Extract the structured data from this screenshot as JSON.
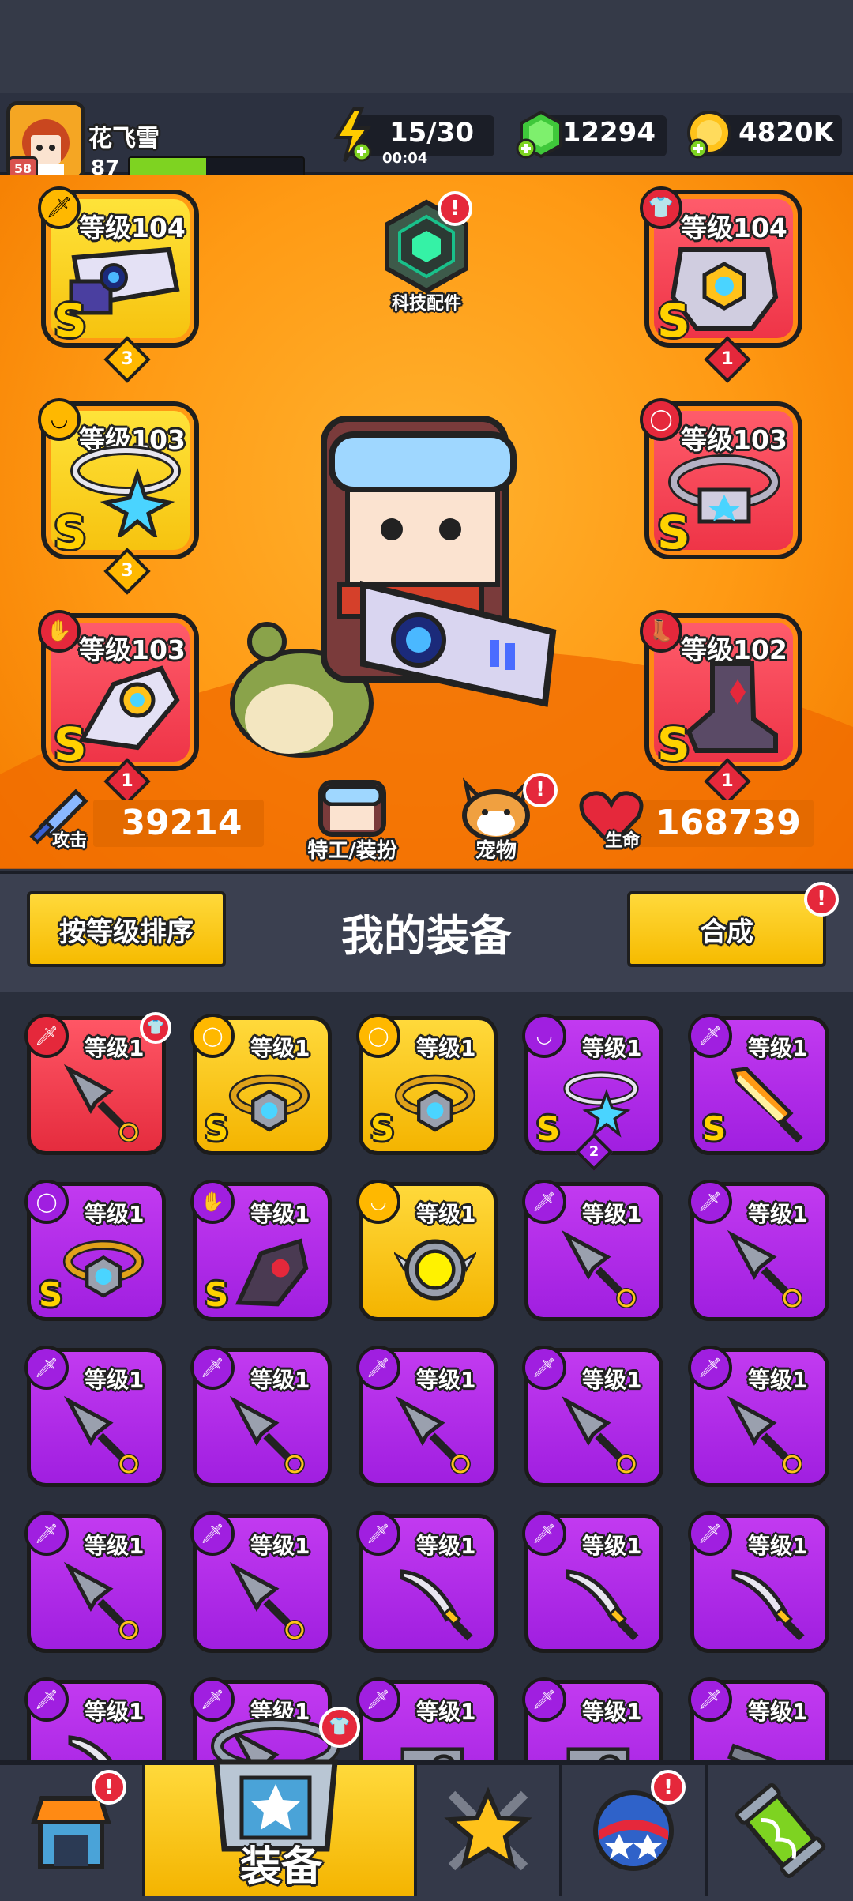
{
  "player": {
    "name": "花飞雪",
    "avatar_level": "58",
    "xp_level": "87",
    "xp_fraction": 0.44
  },
  "resources": {
    "energy": "15/30",
    "energy_timer": "00:04",
    "gems": "12294",
    "coins": "4820K"
  },
  "equipped": {
    "weapon": {
      "label": "等级104",
      "grade": "S",
      "stars": "3"
    },
    "armor": {
      "label": "等级104",
      "grade": "S",
      "stars": "1"
    },
    "necklace": {
      "label": "等级103",
      "grade": "S",
      "stars": "3"
    },
    "belt": {
      "label": "等级103",
      "grade": "S"
    },
    "glove": {
      "label": "等级103",
      "grade": "S",
      "stars": "1"
    },
    "boots": {
      "label": "等级102",
      "grade": "S",
      "stars": "1"
    }
  },
  "tech_parts_label": "科技配件",
  "stats": {
    "attack_label": "攻击",
    "attack_value": "39214",
    "hp_label": "生命",
    "hp_value": "168739"
  },
  "agent_label": "特工/装扮",
  "pet_label": "宠物",
  "inventory": {
    "sort_button": "按等级排序",
    "title": "我的装备",
    "merge_button": "合成",
    "items": [
      {
        "level": "等级1",
        "quality": "red",
        "type": "kunai",
        "grade": ""
      },
      {
        "level": "等级1",
        "quality": "yellow",
        "type": "belt",
        "grade": "S"
      },
      {
        "level": "等级1",
        "quality": "yellow",
        "type": "belt",
        "grade": "S"
      },
      {
        "level": "等级1",
        "quality": "purple",
        "type": "necklace",
        "grade": "S",
        "stars": "2"
      },
      {
        "level": "等级1",
        "quality": "purple",
        "type": "sword",
        "grade": "S"
      },
      {
        "level": "等级1",
        "quality": "purple",
        "type": "belt",
        "grade": "S"
      },
      {
        "level": "等级1",
        "quality": "purple",
        "type": "glove",
        "grade": "S"
      },
      {
        "level": "等级1",
        "quality": "yellow",
        "type": "ring",
        "grade": ""
      },
      {
        "level": "等级1",
        "quality": "purple",
        "type": "kunai",
        "grade": ""
      },
      {
        "level": "等级1",
        "quality": "purple",
        "type": "kunai",
        "grade": ""
      },
      {
        "level": "等级1",
        "quality": "purple",
        "type": "kunai",
        "grade": ""
      },
      {
        "level": "等级1",
        "quality": "purple",
        "type": "kunai",
        "grade": ""
      },
      {
        "level": "等级1",
        "quality": "purple",
        "type": "kunai",
        "grade": ""
      },
      {
        "level": "等级1",
        "quality": "purple",
        "type": "kunai",
        "grade": ""
      },
      {
        "level": "等级1",
        "quality": "purple",
        "type": "kunai",
        "grade": ""
      },
      {
        "level": "等级1",
        "quality": "purple",
        "type": "kunai",
        "grade": ""
      },
      {
        "level": "等级1",
        "quality": "purple",
        "type": "kunai",
        "grade": ""
      },
      {
        "level": "等级1",
        "quality": "purple",
        "type": "katana",
        "grade": ""
      },
      {
        "level": "等级1",
        "quality": "purple",
        "type": "katana",
        "grade": ""
      },
      {
        "level": "等级1",
        "quality": "purple",
        "type": "katana",
        "grade": ""
      },
      {
        "level": "等级1",
        "quality": "purple",
        "type": "katana",
        "grade": ""
      },
      {
        "level": "等级1",
        "quality": "purple",
        "type": "kunai",
        "grade": ""
      },
      {
        "level": "等级1",
        "quality": "purple",
        "type": "revolver",
        "grade": ""
      },
      {
        "level": "等级1",
        "quality": "purple",
        "type": "revolver",
        "grade": ""
      },
      {
        "level": "等级1",
        "quality": "purple",
        "type": "shotgun",
        "grade": ""
      }
    ]
  },
  "nav": {
    "shop": "shop-icon",
    "equipment_label": "装备",
    "battle": "battle-star-icon",
    "gacha": "gacha-ball-icon",
    "lab": "lab-icon"
  }
}
